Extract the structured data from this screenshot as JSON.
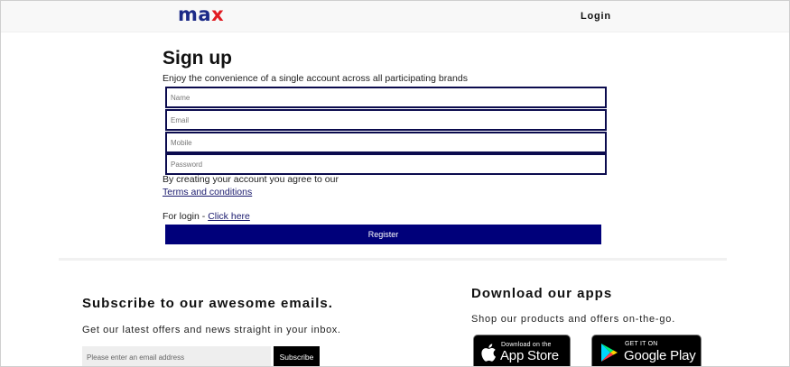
{
  "header": {
    "logo": {
      "part1": "ma",
      "part2": "x"
    },
    "login_label": "Login"
  },
  "signup": {
    "title": "Sign up",
    "subtitle": "Enjoy the convenience of a single account across all participating brands",
    "fields": {
      "name_placeholder": "Name",
      "email_placeholder": "Email",
      "mobile_placeholder": "Mobile",
      "password_placeholder": "Password"
    },
    "agree_text": "By creating your account you agree to our",
    "terms_link": "Terms and conditions",
    "login_prefix": "For login - ",
    "login_link": "Click here",
    "register_label": "Register"
  },
  "subscribe": {
    "title": "Subscribe to our awesome emails.",
    "text": "Get our latest offers and news straight in your inbox.",
    "email_placeholder": "Please enter an email address",
    "button_label": "Subscribe"
  },
  "apps": {
    "title": "Download our apps",
    "text": "Shop our products and offers on-the-go.",
    "app_store": {
      "small": "Download on the",
      "big": "App Store"
    },
    "google_play": {
      "small": "GET IT ON",
      "big": "Google Play"
    }
  },
  "colors": {
    "brand_blue": "#1b2a87",
    "brand_red": "#e11b22",
    "register_bg": "#00007a",
    "field_border": "#0b0b4e"
  }
}
